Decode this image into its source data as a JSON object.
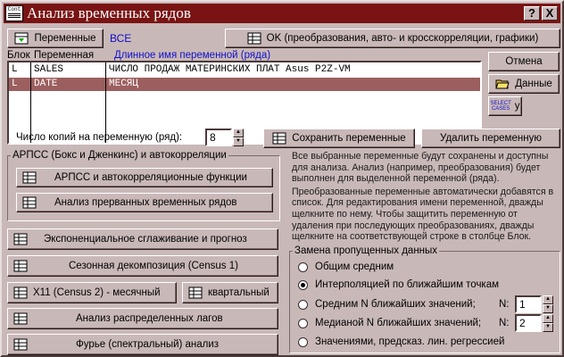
{
  "window": {
    "title": "Анализ временных рядов",
    "icon_text": "Cont\nCOD",
    "help_label": "?",
    "close_label": "X"
  },
  "toolbar": {
    "variables_label": "Переменные",
    "variables_value": "ВСЕ",
    "ok_label": "OK (преобразования, авто- и кросскорреляции, графики)"
  },
  "list": {
    "header_block": "Блок",
    "header_variable": "Переменная",
    "header_longname": "Длинное имя переменной (ряда)",
    "rows": [
      {
        "block": "L",
        "variable": "SALES",
        "longname": "ЧИСЛО ПРОДАЖ МАТЕРИНСКИХ ПЛАТ Asus P2Z-VM",
        "selected": false
      },
      {
        "block": "L",
        "variable": "DATE",
        "longname": "МЕСЯЦ",
        "selected": true
      }
    ]
  },
  "side_buttons": {
    "cancel": "Отмена",
    "data": "Данные",
    "select_cases_icon": "SELECT\nCASES",
    "select_cases_label": "у"
  },
  "copies": {
    "label": "Число копий на переменную (ряд):",
    "value": "8"
  },
  "save_button": "Сохранить переменные",
  "delete_button": "Удалить переменную",
  "arima_group": {
    "title": "АРПСС (Бокс и Дженкинс)  и  автокорреляции",
    "arima_button": "АРПСС и автокорреляционные функции",
    "interrupted_button": "Анализ прерванных временных рядов"
  },
  "analysis_buttons": {
    "exp_smoothing": "Экспоненциальное сглаживание и прогноз",
    "seasonal": "Сезонная декомпозиция (Census 1)",
    "x11_monthly": "X11 (Census 2) - месячный",
    "quarterly": "квартальный",
    "lags": "Анализ распределенных лагов",
    "fourier": "Фурье (спектральный) анализ"
  },
  "info": {
    "p1": "Все выбранные переменные будут сохранены и доступны для анализа. Анализ (например, преобразования) будет выполнен для выделенной переменной (ряда).",
    "p2": "Преобразованные переменные автоматически добавятся в список. Для редактирования имени переменной, дважды щелкните по нему. Чтобы защитить переменную от удаления при последующих преобразованиях, дважды щелкните на соответствующей строке в столбце Блок."
  },
  "missing_group": {
    "title": "Замена пропущенных данных",
    "options": [
      {
        "label": "Общим средним",
        "checked": false
      },
      {
        "label": "Интерполяцией по ближайшим точкам",
        "checked": true
      },
      {
        "label": "Средним N ближайших значений;",
        "checked": false
      },
      {
        "label": "Медианой N ближайших значений;",
        "checked": false
      },
      {
        "label": "Значениями, предсказ. лин. регрессией",
        "checked": false
      }
    ],
    "n_label": "N:",
    "mean_n": "1",
    "median_n": "2"
  }
}
